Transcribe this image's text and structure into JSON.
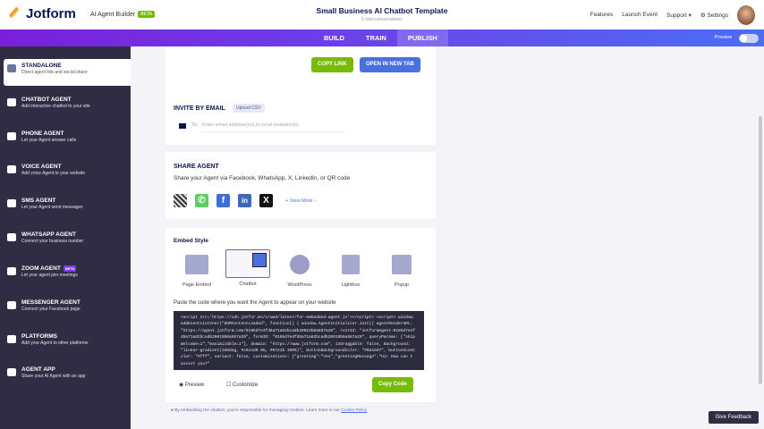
{
  "header": {
    "logo": "Jotform",
    "builder": "AI Agent Builder",
    "beta": "BETA",
    "title": "Small Business AI Chatbot Template",
    "subtitle": "6 total conversations",
    "nav": [
      "Features",
      "Launch Event",
      "Support ▾",
      "⚙ Settings"
    ]
  },
  "tabs": [
    "BUILD",
    "TRAIN",
    "PUBLISH"
  ],
  "preview_label": "Preview",
  "sidebar": [
    {
      "label": "STANDALONE",
      "desc": "Direct agent link and social share"
    },
    {
      "label": "CHATBOT AGENT",
      "desc": "Add interactive chatbot to your site"
    },
    {
      "label": "PHONE AGENT",
      "desc": "Let your Agent answer calls"
    },
    {
      "label": "VOICE AGENT",
      "desc": "Add voice Agent to your website"
    },
    {
      "label": "SMS AGENT",
      "desc": "Let your Agent send messages"
    },
    {
      "label": "WHATSAPP AGENT",
      "desc": "Connect your business number"
    },
    {
      "label": "ZOOM AGENT",
      "desc": "Let your agent join meetings",
      "badge": "BETA"
    },
    {
      "label": "MESSENGER AGENT",
      "desc": "Connect your Facebook page"
    },
    {
      "label": "PLATFORMS",
      "desc": "Add your Agent to other platforms"
    },
    {
      "label": "AGENT APP",
      "desc": "Share your AI Agent with an app"
    }
  ],
  "link": {
    "copy": "COPY LINK",
    "open": "OPEN IN NEW TAB"
  },
  "invite": {
    "title": "INVITE BY EMAIL",
    "upload": "Upload CSV",
    "to": "To:",
    "placeholder": "Enter email address(es) to send invitation(s)"
  },
  "share": {
    "title": "SHARE AGENT",
    "desc": "Share your Agent via Facebook, WhatsApp, X, LinkedIn, or QR code",
    "view_more": "+ View More ›"
  },
  "embed": {
    "title": "Embed Style",
    "options": [
      "Page Embed",
      "Chatbot",
      "WordPress",
      "Lightbox",
      "Popup"
    ],
    "instruction": "Paste the code where you want the Agent to appear on your website",
    "code": "<script src='https://cdn.jotfor.ms/s/umd/latest/for-embedded-agent.js'></script> <script> window.addEventListener(\"DOMContentLoaded\", function() { window.AgentInitializer.init({ agentRenderURL: \"https://agent.jotform.com/0195d7e4fd6a71a82bcadb20019b0a587a20\", rootId: \"JotformAgent-0195d7e4fd6a71a82bcadb20019b0a587a20\", formID: \"0195d7e4fd6a71a82bcadb20019b0a587a20\", queryParams: [\"skipWelcome=1\",\"maximizable=1\"], domain: \"https://www.jotform.com\", isDraggable: false, background: \"linear-gradient(180deg, #c8ced0 0%, #07215 100%)\", buttonBackgroundColor: \"#0a1597\", buttonIconColor: \"#fff\", variant: false, customizations: {\"greeting\":\"Yes\",\"greetingMessage\":\"Hi! How can I assist you?\"",
    "preview": "Preview",
    "customize": "Customize",
    "copy_code": "Copy Code"
  },
  "cookie_note": "By embedding the chatbot, you're responsible for managing cookies. Learn more in our",
  "cookie_link": "Cookie Policy",
  "feedback": "Give Feedback",
  "colors": {
    "green": "#78bb07",
    "blue": "#4a6fe0",
    "sidebar": "#2f2c44"
  }
}
